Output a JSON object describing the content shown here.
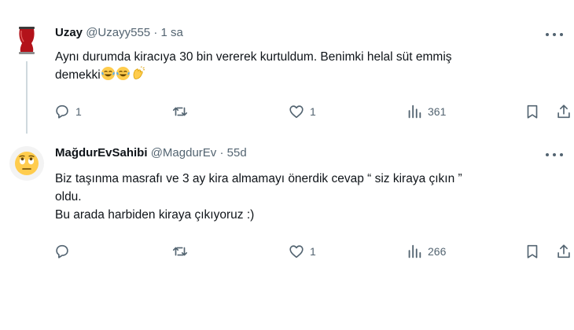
{
  "tweets": [
    {
      "name": "Uzay",
      "handle": "@Uzayy555",
      "separator": "·",
      "time": "1 sa",
      "text_line1": "Aynı durumda kiracıya 30 bin vererek kurtuldum. Benimki helal süt emmiş",
      "text_line2": "demekki",
      "emojis": [
        "face-with-tears-of-joy",
        "face-with-tears-of-joy",
        "clapping-hands"
      ],
      "reply_count": "1",
      "retweet_count": "",
      "like_count": "1",
      "view_count": "361"
    },
    {
      "name": "MağdurEvSahibi",
      "handle": "@MagdurEv",
      "separator": "·",
      "time": "55d",
      "text_line1": "Biz taşınma masrafı ve 3 ay kira almamayı önerdik cevap “ siz kiraya çıkın ”",
      "text_line2": "oldu.",
      "text_line3": "Bu arada harbiden kiraya çıkıyoruz :)",
      "reply_count": "",
      "retweet_count": "",
      "like_count": "1",
      "view_count": "266"
    }
  ],
  "colors": {
    "text": "#0f1419",
    "secondary": "#536471",
    "thread_line": "#cfd9de"
  }
}
